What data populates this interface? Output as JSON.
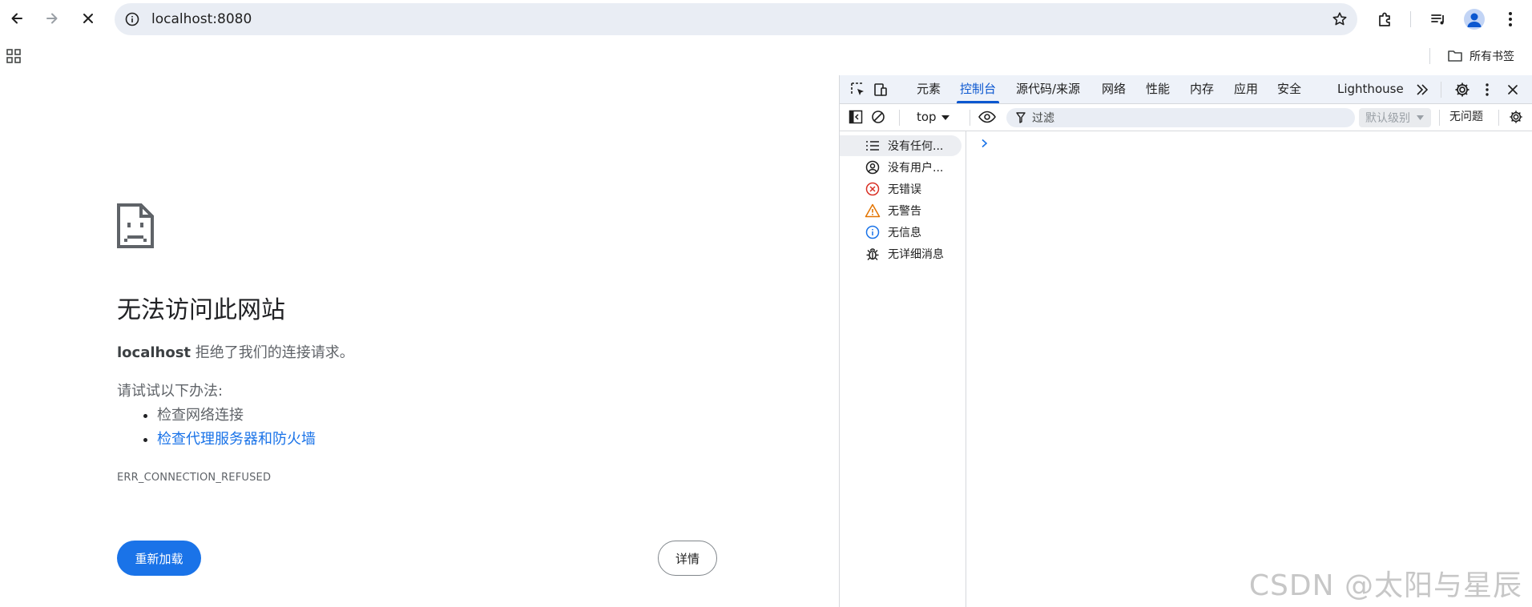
{
  "browser": {
    "url": "localhost:8080",
    "icons": {
      "back": "arrow-left-icon",
      "forward": "arrow-right-icon",
      "stop": "close-icon",
      "site_info": "info-circle-icon",
      "bookmark_star": "star-icon",
      "extensions": "puzzle-icon",
      "reading_list": "playlist-icon",
      "profile": "avatar-icon",
      "menu": "kebab-icon"
    }
  },
  "bookmarks": {
    "apps_icon": "apps-grid-icon",
    "all_bookmarks_label": "所有书签"
  },
  "error_page": {
    "title": "无法访问此网站",
    "host": "localhost",
    "summary_rest": " 拒绝了我们的连接请求。",
    "try_label": "请试试以下办法:",
    "suggestions": [
      "检查网络连接",
      "检查代理服务器和防火墙"
    ],
    "error_code": "ERR_CONNECTION_REFUSED",
    "reload_label": "重新加载",
    "details_label": "详情"
  },
  "devtools": {
    "tabs": [
      "元素",
      "控制台",
      "源代码/来源",
      "网络",
      "性能",
      "内存",
      "应用",
      "安全",
      "Lighthouse"
    ],
    "active_tab": "控制台",
    "context": "top",
    "filter_placeholder": "过滤",
    "level_label": "默认级别",
    "issues_label": "无问题",
    "sidebar": [
      {
        "label": "没有任何...",
        "icon": "list-icon"
      },
      {
        "label": "没有用户...",
        "icon": "user-circle-icon"
      },
      {
        "label": "无错误",
        "icon": "error-circle-icon"
      },
      {
        "label": "无警告",
        "icon": "warning-triangle-icon"
      },
      {
        "label": "无信息",
        "icon": "info-circle-icon"
      },
      {
        "label": "无详细消息",
        "icon": "bug-icon"
      }
    ]
  },
  "colors": {
    "accent": "#1a73e8",
    "devtools_active": "#0b57d0",
    "error_red": "#d93025",
    "warning_orange": "#e37400"
  },
  "watermark": "CSDN @太阳与星辰"
}
